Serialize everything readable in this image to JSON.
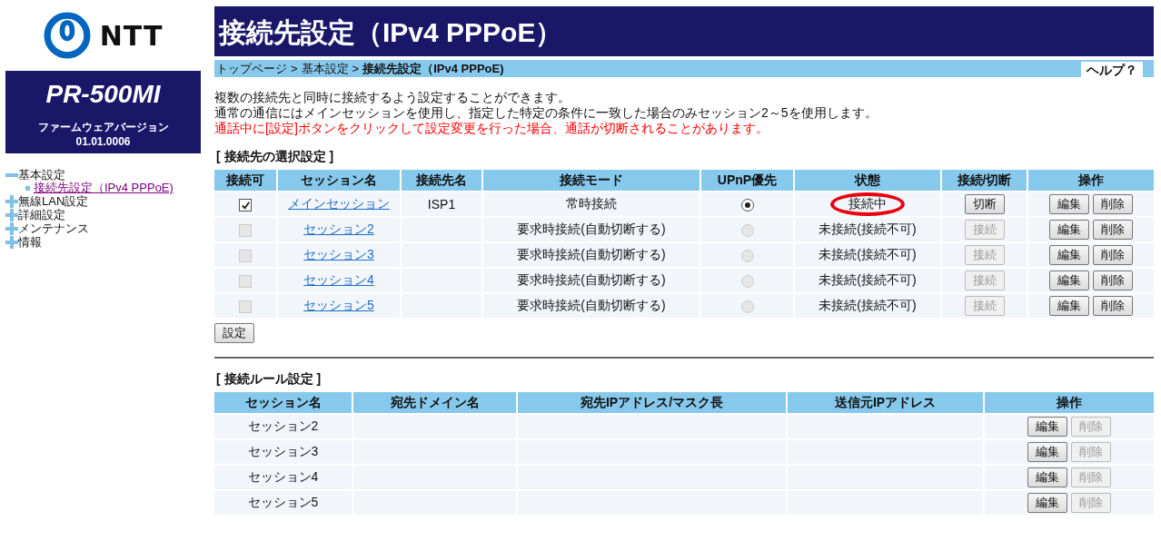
{
  "logo": {
    "text": "NTT"
  },
  "product": {
    "model": "PR-500MI",
    "firmware_label": "ファームウェアバージョン",
    "firmware_version": "01.01.0006"
  },
  "sidebar": {
    "items": [
      {
        "label": "基本設定",
        "expanded": true,
        "children": [
          {
            "label": "接続先設定（IPv4 PPPoE)",
            "selected": true
          }
        ]
      },
      {
        "label": "無線LAN設定",
        "expanded": false
      },
      {
        "label": "詳細設定",
        "expanded": false
      },
      {
        "label": "メンテナンス",
        "expanded": false
      },
      {
        "label": "情報",
        "expanded": false
      }
    ]
  },
  "page_title": "接続先設定（IPv4 PPPoE）",
  "breadcrumb": [
    "トップページ",
    "基本設定",
    "接続先設定（IPv4 PPPoE)"
  ],
  "breadcrumb_separator": ">",
  "help": "ヘルプ？",
  "description": [
    {
      "text": "複数の接続先と同時に接続するよう設定することができます。",
      "kind": "normal"
    },
    {
      "text": "通常の通信にはメインセッションを使用し、指定した特定の条件に一致した場合のみセッション2～5を使用します。",
      "kind": "normal"
    },
    {
      "text": "通話中に[設定]ボタンをクリックして設定変更を行った場合、通話が切断されることがあります。",
      "kind": "warning"
    }
  ],
  "selection": {
    "heading": "[ 接続先の選択設定 ]",
    "columns": [
      "接続可",
      "セッション名",
      "接続先名",
      "接続モード",
      "UPnP優先",
      "状態",
      "接続/切断",
      "操作"
    ],
    "rows": [
      {
        "enabled": {
          "checked": true,
          "disabled": false
        },
        "session": "メインセッション",
        "destination": "ISP1",
        "mode": "常時接続",
        "upnp": {
          "selected": true,
          "disabled": false
        },
        "status": "接続中",
        "status_circled": true,
        "connect": {
          "label": "切断",
          "disabled": false
        },
        "edit": "編集",
        "delete": "削除"
      },
      {
        "enabled": {
          "checked": false,
          "disabled": true
        },
        "session": "セッション2",
        "mode": "要求時接続(自動切断する)",
        "upnp": {
          "selected": false,
          "disabled": true
        },
        "status": "未接続(接続不可)",
        "status_circled": false,
        "connect": {
          "label": "接続",
          "disabled": true
        },
        "edit": "編集",
        "delete": "削除"
      },
      {
        "enabled": {
          "checked": false,
          "disabled": true
        },
        "session": "セッション3",
        "mode": "要求時接続(自動切断する)",
        "upnp": {
          "selected": false,
          "disabled": true
        },
        "status": "未接続(接続不可)",
        "status_circled": false,
        "connect": {
          "label": "接続",
          "disabled": true
        },
        "edit": "編集",
        "delete": "削除"
      },
      {
        "enabled": {
          "checked": false,
          "disabled": true
        },
        "session": "セッション4",
        "mode": "要求時接続(自動切断する)",
        "upnp": {
          "selected": false,
          "disabled": true
        },
        "status": "未接続(接続不可)",
        "status_circled": false,
        "connect": {
          "label": "接続",
          "disabled": true
        },
        "edit": "編集",
        "delete": "削除"
      },
      {
        "enabled": {
          "checked": false,
          "disabled": true
        },
        "session": "セッション5",
        "mode": "要求時接続(自動切断する)",
        "upnp": {
          "selected": false,
          "disabled": true
        },
        "status": "未接続(接続不可)",
        "status_circled": false,
        "connect": {
          "label": "接続",
          "disabled": true
        },
        "edit": "編集",
        "delete": "削除"
      }
    ],
    "submit": "設定"
  },
  "rules": {
    "heading": "[ 接続ルール設定 ]",
    "columns": [
      "セッション名",
      "宛先ドメイン名",
      "宛先IPアドレス/マスク長",
      "送信元IPアドレス",
      "操作"
    ],
    "rows": [
      {
        "session": "セッション2",
        "edit": "編集",
        "delete": {
          "label": "削除",
          "disabled": true
        }
      },
      {
        "session": "セッション3",
        "edit": "編集",
        "delete": {
          "label": "削除",
          "disabled": true
        }
      },
      {
        "session": "セッション4",
        "edit": "編集",
        "delete": {
          "label": "削除",
          "disabled": true
        }
      },
      {
        "session": "セッション5",
        "edit": "編集",
        "delete": {
          "label": "削除",
          "disabled": true
        }
      }
    ]
  }
}
